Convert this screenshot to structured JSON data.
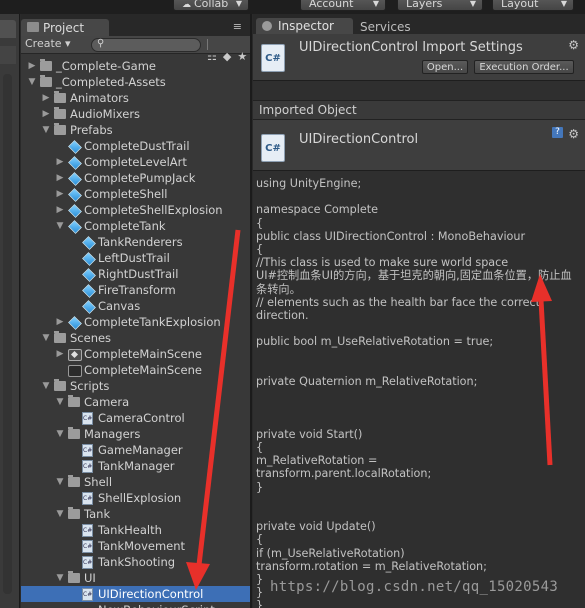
{
  "toolbar": {
    "collab": "Collab",
    "account": "Account",
    "layers": "Layers",
    "layout": "Layout"
  },
  "project": {
    "tab": "Project",
    "tab_menu": "≡",
    "create": "Create ▾",
    "tree": [
      {
        "label": "_Complete-Game",
        "depth": 0,
        "type": "folder",
        "arrow": "right"
      },
      {
        "label": "_Completed-Assets",
        "depth": 0,
        "type": "folder",
        "arrow": "down"
      },
      {
        "label": "Animators",
        "depth": 1,
        "type": "folder",
        "arrow": "right"
      },
      {
        "label": "AudioMixers",
        "depth": 1,
        "type": "folder",
        "arrow": "right"
      },
      {
        "label": "Prefabs",
        "depth": 1,
        "type": "folder",
        "arrow": "down"
      },
      {
        "label": "CompleteDustTrail",
        "depth": 2,
        "type": "cube",
        "arrow": ""
      },
      {
        "label": "CompleteLevelArt",
        "depth": 2,
        "type": "cube",
        "arrow": "right"
      },
      {
        "label": "CompletePumpJack",
        "depth": 2,
        "type": "cube",
        "arrow": "right"
      },
      {
        "label": "CompleteShell",
        "depth": 2,
        "type": "cube",
        "arrow": "right"
      },
      {
        "label": "CompleteShellExplosion",
        "depth": 2,
        "type": "cube",
        "arrow": "right"
      },
      {
        "label": "CompleteTank",
        "depth": 2,
        "type": "cube",
        "arrow": "down"
      },
      {
        "label": "TankRenderers",
        "depth": 3,
        "type": "cube",
        "arrow": ""
      },
      {
        "label": "LeftDustTrail",
        "depth": 3,
        "type": "cube",
        "arrow": ""
      },
      {
        "label": "RightDustTrail",
        "depth": 3,
        "type": "cube",
        "arrow": ""
      },
      {
        "label": "FireTransform",
        "depth": 3,
        "type": "cube",
        "arrow": ""
      },
      {
        "label": "Canvas",
        "depth": 3,
        "type": "cube",
        "arrow": ""
      },
      {
        "label": "CompleteTankExplosion",
        "depth": 2,
        "type": "cube",
        "arrow": "right"
      },
      {
        "label": "Scenes",
        "depth": 1,
        "type": "folder",
        "arrow": "down"
      },
      {
        "label": "CompleteMainScene",
        "depth": 2,
        "type": "scene",
        "arrow": "right"
      },
      {
        "label": "CompleteMainScene",
        "depth": 2,
        "type": "unity",
        "arrow": ""
      },
      {
        "label": "Scripts",
        "depth": 1,
        "type": "folder",
        "arrow": "down"
      },
      {
        "label": "Camera",
        "depth": 2,
        "type": "folder",
        "arrow": "down"
      },
      {
        "label": "CameraControl",
        "depth": 3,
        "type": "script",
        "arrow": ""
      },
      {
        "label": "Managers",
        "depth": 2,
        "type": "folder",
        "arrow": "down"
      },
      {
        "label": "GameManager",
        "depth": 3,
        "type": "script",
        "arrow": ""
      },
      {
        "label": "TankManager",
        "depth": 3,
        "type": "script",
        "arrow": ""
      },
      {
        "label": "Shell",
        "depth": 2,
        "type": "folder",
        "arrow": "down"
      },
      {
        "label": "ShellExplosion",
        "depth": 3,
        "type": "script",
        "arrow": ""
      },
      {
        "label": "Tank",
        "depth": 2,
        "type": "folder",
        "arrow": "down"
      },
      {
        "label": "TankHealth",
        "depth": 3,
        "type": "script",
        "arrow": ""
      },
      {
        "label": "TankMovement",
        "depth": 3,
        "type": "script",
        "arrow": ""
      },
      {
        "label": "TankShooting",
        "depth": 3,
        "type": "script",
        "arrow": ""
      },
      {
        "label": "UI",
        "depth": 2,
        "type": "folder",
        "arrow": "down"
      },
      {
        "label": "UIDirectionControl",
        "depth": 3,
        "type": "script",
        "arrow": "",
        "selected": true
      }
    ],
    "partial_row": "NewBehaviourScript"
  },
  "inspector": {
    "tab": "Inspector",
    "tab2": "Services",
    "title": "UIDirectionControl Import Settings",
    "open_btn": "Open...",
    "exec_btn": "Execution Order...",
    "section": "Imported Object",
    "object_name": "UIDirectionControl",
    "icon_text": "C#",
    "code": [
      "using UnityEngine;",
      "",
      "namespace Complete",
      "{",
      "    public class UIDirectionControl : MonoBehaviour",
      "    {",
      "        //This class is used to make sure world space",
      "UI#控制血条UI的方向，基于坦克的朝向,固定血条位置，防止血",
      "条转向。",
      "        // elements such as the health bar face the correct",
      "direction.",
      "",
      "        public bool m_UseRelativeRotation = true;",
      "",
      "",
      "        private Quaternion m_RelativeRotation;",
      "",
      "",
      "",
      "        private void Start()",
      "        {",
      "            m_RelativeRotation =",
      "transform.parent.localRotation;",
      "        }",
      "",
      "",
      "        private void Update()",
      "        {",
      "            if (m_UseRelativeRotation)",
      "                transform.rotation = m_RelativeRotation;",
      "        }",
      "    }",
      "}"
    ]
  },
  "watermark": "https://blog.csdn.net/qq_15020543",
  "colors": {
    "selection": "#3d6fb6",
    "arrow": "#e8302a"
  }
}
